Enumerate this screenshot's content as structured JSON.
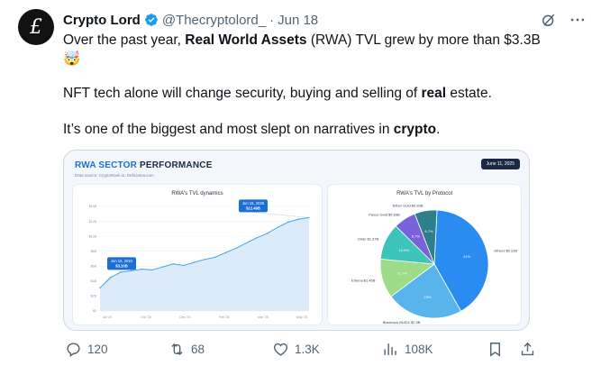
{
  "author": {
    "name": "Crypto Lord",
    "handle": "@Thecryptolord_",
    "separator": "·",
    "date": "Jun 18",
    "avatar_glyph": "£"
  },
  "icons": {
    "verified": "verified-badge-icon",
    "grok": "grok-icon",
    "more": "more-icon",
    "reply": "reply-icon",
    "retweet": "retweet-icon",
    "like": "heart-icon",
    "views": "views-icon",
    "bookmark": "bookmark-icon",
    "share": "share-icon"
  },
  "text": {
    "p1_a": "Over the past year, ",
    "p1_b": "Real World Assets",
    "p1_c": " (RWA) TVL grew by more than $3.3B",
    "p1_emoji": "🤯",
    "p2_a": "NFT tech alone will change security, buying and selling of ",
    "p2_b": "real",
    "p2_c": " estate.",
    "p3_a": "It’s one of the biggest and most slept on narratives in ",
    "p3_b": "crypto",
    "p3_c": "."
  },
  "media": {
    "title_a": "RWA SECTOR",
    "title_b": " PERFORMANCE",
    "source": "Data source: CryptoRank.io, DefiLlama.com",
    "date_badge": "June 11, 2025",
    "left_title": "RWA's TVL dynamics",
    "right_title": "RWA's TVL by Protocol",
    "accent": "#1d6fd8",
    "navy": "#1b2a44"
  },
  "chart_data": [
    {
      "type": "area",
      "title": "RWA's TVL dynamics",
      "x_ticks": [
        "Jul '24",
        "Oct '24",
        "Dec '24",
        "Feb '25",
        "Mar '25",
        "May '25"
      ],
      "y_ticks": [
        "$14B",
        "$12B",
        "$10B",
        "$8B",
        "$6B",
        "$4B",
        "$2B",
        "$0"
      ],
      "ylim": [
        0,
        14
      ],
      "x": [
        0,
        0.05,
        0.1,
        0.15,
        0.2,
        0.25,
        0.3,
        0.35,
        0.4,
        0.45,
        0.5,
        0.55,
        0.6,
        0.65,
        0.7,
        0.75,
        0.8,
        0.85,
        0.9,
        0.95,
        1.0
      ],
      "values": [
        3.1,
        4.5,
        5.2,
        5.4,
        5.6,
        5.5,
        5.9,
        6.3,
        6.1,
        6.5,
        6.9,
        7.2,
        7.8,
        8.4,
        9.1,
        9.8,
        10.4,
        11.2,
        11.9,
        12.3,
        12.5
      ],
      "annotations": [
        {
          "label": "Jun 15, 2024",
          "value": "$3.10B"
        },
        {
          "label": "Jun 15, 2025",
          "value": "$12.49B"
        }
      ],
      "color": "#4aa3e8"
    },
    {
      "type": "pie",
      "title": "RWA's TVL by Protocol",
      "slices": [
        {
          "name": "Others $5.12B",
          "value": 41,
          "label": "41%",
          "color": "#2a8bf0"
        },
        {
          "name": "Blackrock BUIDL $2.9B",
          "value": 23,
          "label": "23%",
          "color": "#5ab4ec"
        },
        {
          "name": "Ethena $1.45B",
          "value": 11.7,
          "label": "11.7%",
          "color": "#9edc8a"
        },
        {
          "name": "Ondo $1.37B",
          "value": 10.9,
          "label": "10.9%",
          "color": "#3cc4b8"
        },
        {
          "name": "Paxos Gold $0.83B",
          "value": 6.7,
          "label": "6.7%",
          "color": "#7a63d8"
        },
        {
          "name": "Tether Gold $0.83B",
          "value": 6.7,
          "label": "6.7%",
          "color": "#2e7f8c"
        }
      ]
    }
  ],
  "stats": {
    "replies": "120",
    "retweets": "68",
    "likes": "1.3K",
    "views": "108K"
  }
}
